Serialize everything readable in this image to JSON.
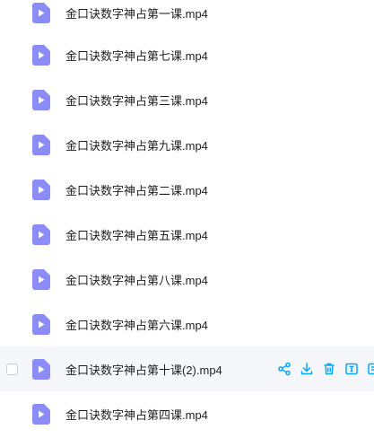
{
  "files": [
    {
      "name": "金口诀数字神占第一课.mp4",
      "icon": "video-file-icon"
    },
    {
      "name": "金口诀数字神占第七课.mp4",
      "icon": "video-file-icon"
    },
    {
      "name": "金口诀数字神占第三课.mp4",
      "icon": "video-file-icon"
    },
    {
      "name": "金口诀数字神占第九课.mp4",
      "icon": "video-file-icon"
    },
    {
      "name": "金口诀数字神占第二课.mp4",
      "icon": "video-file-icon"
    },
    {
      "name": "金口诀数字神占第五课.mp4",
      "icon": "video-file-icon"
    },
    {
      "name": "金口诀数字神占第八课.mp4",
      "icon": "video-file-icon"
    },
    {
      "name": "金口诀数字神占第六课.mp4",
      "icon": "video-file-icon"
    },
    {
      "name": "金口诀数字神占第十课(2).mp4",
      "icon": "video-file-icon",
      "hovered": true
    },
    {
      "name": "金口诀数字神占第四课.mp4",
      "icon": "video-file-icon"
    }
  ],
  "row_actions": [
    "share-icon",
    "download-icon",
    "delete-icon",
    "rename-icon",
    "more-icon"
  ],
  "colors": {
    "icon_purple": "#8b8cf7",
    "action_blue": "#06a7ff",
    "hover_bg": "#f5f7fa",
    "text": "#1f1f1f"
  }
}
